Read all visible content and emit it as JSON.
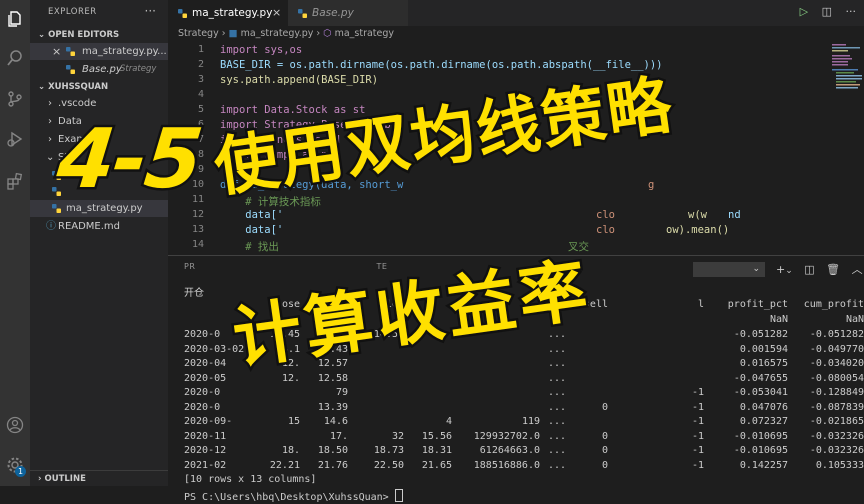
{
  "sidebar": {
    "title": "EXPLORER",
    "open_editors_label": "OPEN EDITORS",
    "open_editors": [
      {
        "name": "ma_strategy.py...",
        "tag": ""
      },
      {
        "name": "Base.py",
        "tag": "Strategy"
      }
    ],
    "workspace_label": "XUHSSQUAN",
    "tree": [
      ".vscode",
      "Data",
      "Exam",
      "Str",
      "ma_strategy.py",
      "README.md"
    ],
    "outline_label": "OUTLINE",
    "badge": "1"
  },
  "tabs": [
    {
      "label": "ma_strategy.py",
      "active": true
    },
    {
      "label": "Base.py",
      "active": false
    }
  ],
  "breadcrumb": [
    "Strategy",
    "ma_strategy.py",
    "ma_strategy"
  ],
  "code": {
    "line_numbers": [
      "1",
      "2",
      "3",
      "4",
      "5",
      "6",
      "7",
      "8",
      "9",
      "10",
      "11",
      "12",
      "13",
      "14"
    ],
    "lines": [
      "import sys,os",
      "BASE_DIR = os.path.dirname(os.path.dirname(os.path.abspath(__file__)))",
      "sys.path.append(BASE_DIR)",
      "",
      "import Data.Stock as st",
      "import Strategy.Base as stb",
      "import pandas as pd",
      "import numpy as np",
      "",
      "def ma_strategy(data, short_w",
      "    # 计算技术指标",
      "    data['",
      "    data['",
      "    # 找出"
    ],
    "fragment_12": "clo",
    "fragment_12b": "w(w",
    "fragment_12c": "nd",
    "fragment_13": "clo",
    "fragment_13b": "ow).mean()",
    "fragment_10": "g",
    "fragment_14": "叉交"
  },
  "panel": {
    "tab_label": "PR",
    "tab_label_2": "TE",
    "terminal_select": "",
    "terminal": {
      "first_line": "开仓",
      "headers": [
        "",
        "ose",
        "high",
        "low",
        "sell",
        "l",
        "profit_pct",
        "cum_profit"
      ],
      "nan_row": [
        "NaN",
        "NaN"
      ],
      "rows": [
        {
          "date": "2020-0",
          "c1": "14.45",
          "c2": "14.41",
          "c3": "14.50",
          "c4": "",
          "c5": "",
          "sell": "",
          "l": "",
          "pct": "-0.051282",
          "cum": "-0.051282"
        },
        {
          "date": "2020-03-02",
          "c1": "14.1",
          "c2": "14.43",
          "c3": "",
          "c4": "",
          "c5": "",
          "sell": "",
          "l": "",
          "pct": "0.001594",
          "cum": "-0.049770"
        },
        {
          "date": "2020-04",
          "c1": "12.",
          "c2": "12.57",
          "c3": "",
          "c4": "",
          "c5": "",
          "sell": "",
          "l": "",
          "pct": "0.016575",
          "cum": "-0.034020"
        },
        {
          "date": "2020-05",
          "c1": "12.",
          "c2": "12.58",
          "c3": "",
          "c4": "",
          "c5": "",
          "sell": "",
          "l": "",
          "pct": "-0.047655",
          "cum": "-0.080054"
        },
        {
          "date": "2020-0",
          "c1": "",
          "c2": "79",
          "c3": "",
          "c4": "",
          "c5": "",
          "sell": "",
          "l": "-1",
          "pct": "-0.053041",
          "cum": "-0.128849"
        },
        {
          "date": "2020-0",
          "c1": "",
          "c2": "13.39",
          "c3": "",
          "c4": "",
          "c5": "",
          "sell": "0",
          "l": "-1",
          "pct": "0.047076",
          "cum": "-0.087839"
        },
        {
          "date": "2020-09-",
          "c1": "15",
          "c2": "14.6",
          "c3": "",
          "c4": "4",
          "c5": "119",
          "sell": "",
          "l": "-1",
          "pct": "0.072327",
          "cum": "-0.021865"
        },
        {
          "date": "2020-11",
          "c1": "",
          "c2": "17.",
          "c3": "32",
          "c4": "15.56",
          "c5": "129932702.0",
          "sell": "0",
          "l": "-1",
          "pct": "-0.010695",
          "cum": "-0.032326"
        },
        {
          "date": "2020-12",
          "c1": "18.",
          "c2": "18.50",
          "c3": "18.73",
          "c4": "18.31",
          "c5": "61264663.0",
          "sell": "0",
          "l": "-1",
          "pct": "-0.010695",
          "cum": "-0.032326"
        },
        {
          "date": "2021-02",
          "c1": "22.21",
          "c2": "21.76",
          "c3": "22.50",
          "c4": "21.65",
          "c5": "188516886.0",
          "sell": "0",
          "l": "-1",
          "pct": "0.142257",
          "cum": "0.105333"
        }
      ],
      "ellipsis": "...",
      "summary": "[10 rows x 13 columns]",
      "prompt": "PS C:\\Users\\hbq\\Desktop\\XuhssQuan> "
    }
  },
  "overlay": {
    "chapter": "4-5",
    "title_line1": "使用双均线策略",
    "title_line2": "计算收益率"
  },
  "colors": {
    "overlay_text": "#ffe000",
    "activity_bar": "#333333",
    "sidebar": "#252526",
    "editor": "#1e1e1e"
  }
}
